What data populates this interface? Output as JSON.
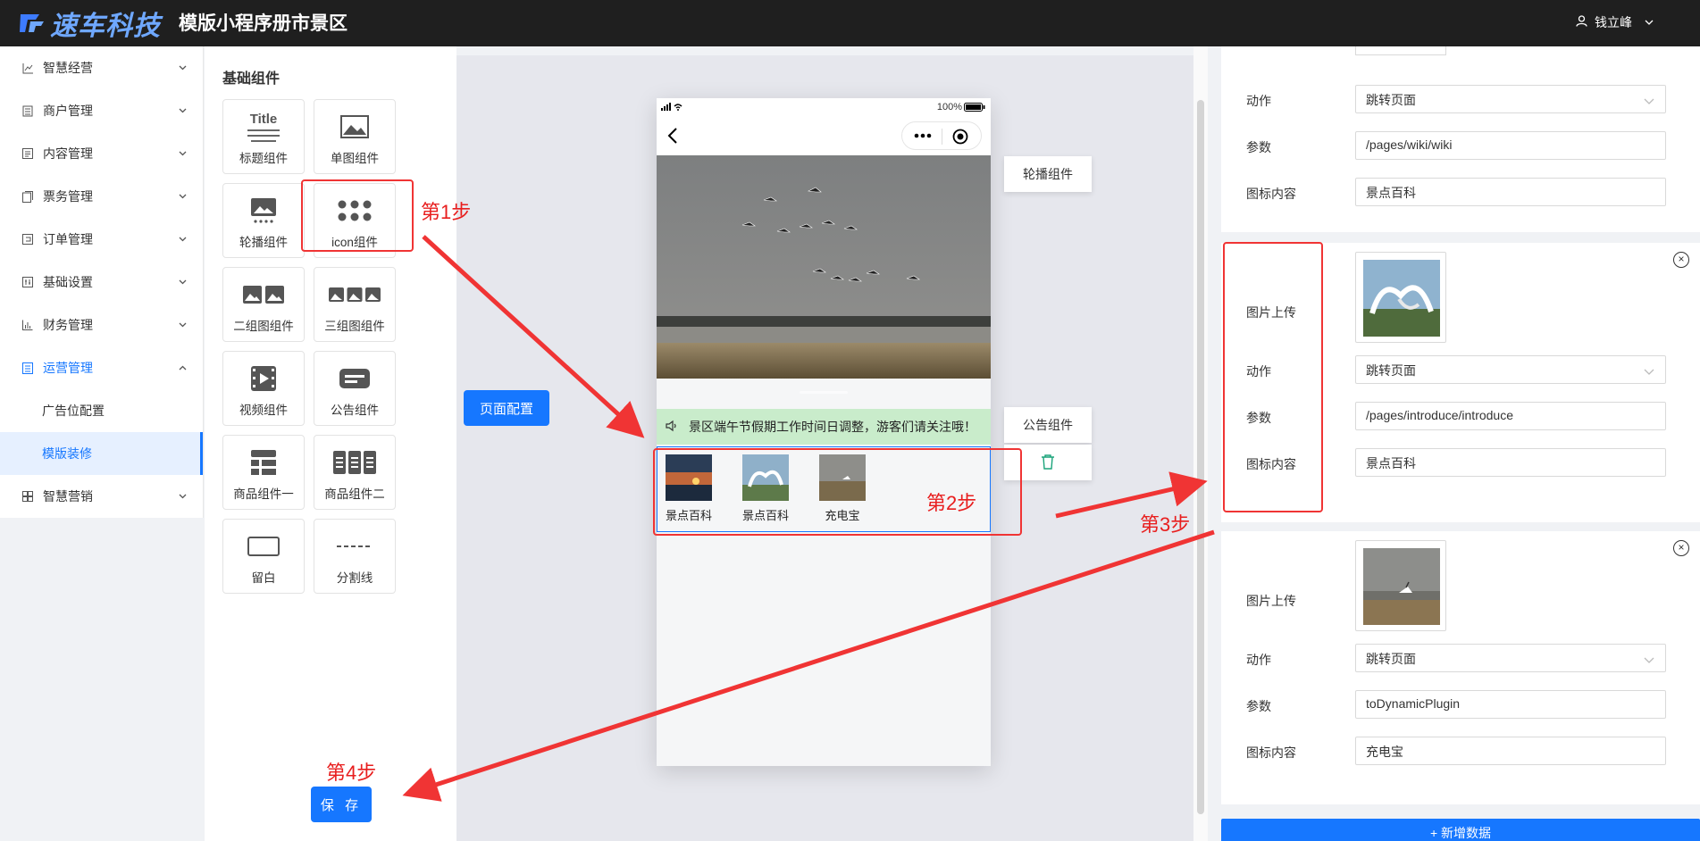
{
  "header": {
    "logo_text": "速车科技",
    "app_title": "模版小程序册市景区",
    "user_name": "钱立峰"
  },
  "sidebar": {
    "items": [
      {
        "label": "智慧经营",
        "icon": "chart-line-icon"
      },
      {
        "label": "商户管理",
        "icon": "building-icon"
      },
      {
        "label": "内容管理",
        "icon": "list-icon"
      },
      {
        "label": "票务管理",
        "icon": "ticket-icon"
      },
      {
        "label": "订单管理",
        "icon": "order-icon"
      },
      {
        "label": "基础设置",
        "icon": "settings-grid-icon"
      },
      {
        "label": "财务管理",
        "icon": "bar-chart-icon"
      },
      {
        "label": "运营管理",
        "icon": "operations-icon"
      },
      {
        "label": "广告位配置"
      },
      {
        "label": "模版装修"
      },
      {
        "label": "智慧营销",
        "icon": "marketing-icon"
      }
    ]
  },
  "components": {
    "title": "基础组件",
    "items": [
      {
        "label": "标题组件"
      },
      {
        "label": "单图组件"
      },
      {
        "label": "轮播组件"
      },
      {
        "label": "icon组件"
      },
      {
        "label": "二组图组件"
      },
      {
        "label": "三组图组件"
      },
      {
        "label": "视频组件"
      },
      {
        "label": "公告组件"
      },
      {
        "label": "商品组件一"
      },
      {
        "label": "商品组件二"
      },
      {
        "label": "留白"
      },
      {
        "label": "分割线"
      }
    ],
    "title_icon_text": "Title"
  },
  "canvas": {
    "page_config_label": "页面配置",
    "save_label": "保 存"
  },
  "phone": {
    "battery": "100%",
    "notice_text": "景区端午节假期工作时间日调整，游客们请关注哦！",
    "icons": [
      {
        "label": "景点百科"
      },
      {
        "label": "景点百科"
      },
      {
        "label": "充电宝"
      }
    ],
    "tags": {
      "carousel": "轮播组件",
      "notice": "公告组件"
    }
  },
  "right_panel": {
    "card1": {
      "action_label": "动作",
      "action_value": "跳转页面",
      "param_label": "参数",
      "param_value": "/pages/wiki/wiki",
      "icon_label": "图标内容",
      "icon_value": "景点百科"
    },
    "card2": {
      "upload_label": "图片上传",
      "action_label": "动作",
      "action_value": "跳转页面",
      "param_label": "参数",
      "param_value": "/pages/introduce/introduce",
      "icon_label": "图标内容",
      "icon_value": "景点百科"
    },
    "card3": {
      "upload_label": "图片上传",
      "action_label": "动作",
      "action_value": "跳转页面",
      "param_label": "参数",
      "param_value": "toDynamicPlugin",
      "icon_label": "图标内容",
      "icon_value": "充电宝"
    },
    "add_label": "+ 新增数据"
  },
  "annotations": {
    "step1": "第1步",
    "step2": "第2步",
    "step3": "第3步",
    "step4": "第4步"
  },
  "colors": {
    "primary": "#1677ff",
    "header_bg": "#1f1f1f",
    "annotation_red": "#f03434",
    "notice_bg": "#c9eccb"
  }
}
